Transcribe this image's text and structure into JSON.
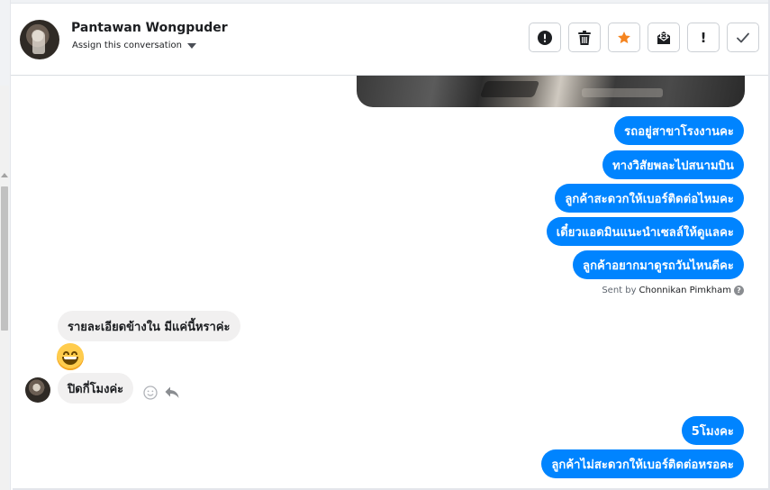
{
  "header": {
    "contact_name": "Pantawan Wongpuder",
    "assign_label": "Assign this conversation",
    "actions": [
      {
        "name": "report-button",
        "icon": "exclamation-circle-icon"
      },
      {
        "name": "delete-button",
        "icon": "trash-icon"
      },
      {
        "name": "star-button",
        "icon": "star-icon",
        "color": "#f5841f"
      },
      {
        "name": "mark-unread-button",
        "icon": "envelope-x-icon"
      },
      {
        "name": "follow-up-button",
        "icon": "exclamation-icon",
        "label": "!"
      },
      {
        "name": "mark-done-button",
        "icon": "checkmark-icon"
      }
    ]
  },
  "messages": {
    "outgoing": [
      "รถอยู่สาขาโรงงานคะ",
      "ทางวิสัยพละไปสนามบิน",
      "ลูกค้าสะดวกให้เบอร์ติดต่อไหมคะ",
      "เดี๋ยวแอดมินแนะนำเซลล์ให้ดูแลคะ",
      "ลูกค้าอยากมาดูรถวันไหนดีคะ"
    ],
    "sent_by_prefix": "Sent by",
    "sent_by_name": "Chonnikan Pimkham",
    "incoming": [
      "รายละเอียดข้างใน มีแค่นี้หราค่ะ",
      "ปิดกี่โมงค่ะ"
    ],
    "incoming_emoji": "grinning-face-emoji",
    "outgoing_latest": [
      "5โมงคะ",
      "ลูกค้าไม่สะดวกให้เบอร์ติดต่อหรอคะ"
    ]
  },
  "colors": {
    "outgoing_bubble": "#0084ff",
    "incoming_bubble": "#f1f0f0",
    "star": "#f5841f"
  }
}
